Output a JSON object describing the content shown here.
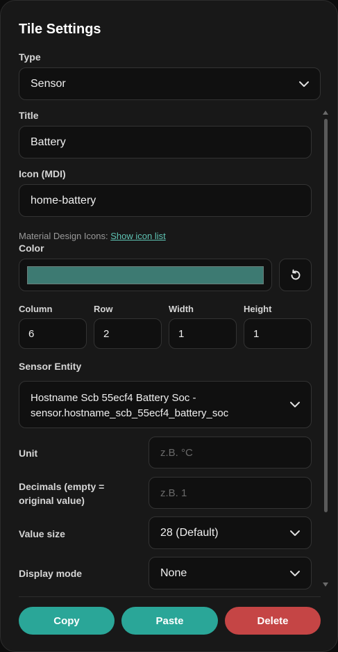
{
  "panel": {
    "title": "Tile Settings"
  },
  "type": {
    "label": "Type",
    "value": "Sensor"
  },
  "title_field": {
    "label": "Title",
    "value": "Battery"
  },
  "icon": {
    "label": "Icon (MDI)",
    "value": "home-battery"
  },
  "help": {
    "prefix": "Material Design Icons: ",
    "link": "Show icon list"
  },
  "color": {
    "label": "Color",
    "value": "#3d7a72"
  },
  "grid": {
    "column": {
      "label": "Column",
      "value": "6"
    },
    "row": {
      "label": "Row",
      "value": "2"
    },
    "width": {
      "label": "Width",
      "value": "1"
    },
    "height": {
      "label": "Height",
      "value": "1"
    }
  },
  "sensor_entity": {
    "label": "Sensor Entity",
    "name": "Hostname Scb 55ecf4 Battery Soc -",
    "id": "sensor.hostname_scb_55ecf4_battery_soc"
  },
  "unit": {
    "label": "Unit",
    "placeholder": "z.B. °C"
  },
  "decimals": {
    "label_line1": "Decimals (empty =",
    "label_line2": "original value)",
    "placeholder": "z.B. 1"
  },
  "value_size": {
    "label": "Value size",
    "value": "28 (Default)"
  },
  "display_mode": {
    "label": "Display mode",
    "value": "None"
  },
  "buttons": {
    "copy": "Copy",
    "paste": "Paste",
    "delete": "Delete"
  },
  "colors": {
    "accent": "#2aa698",
    "danger": "#c54545",
    "link": "#5fc4b4"
  }
}
